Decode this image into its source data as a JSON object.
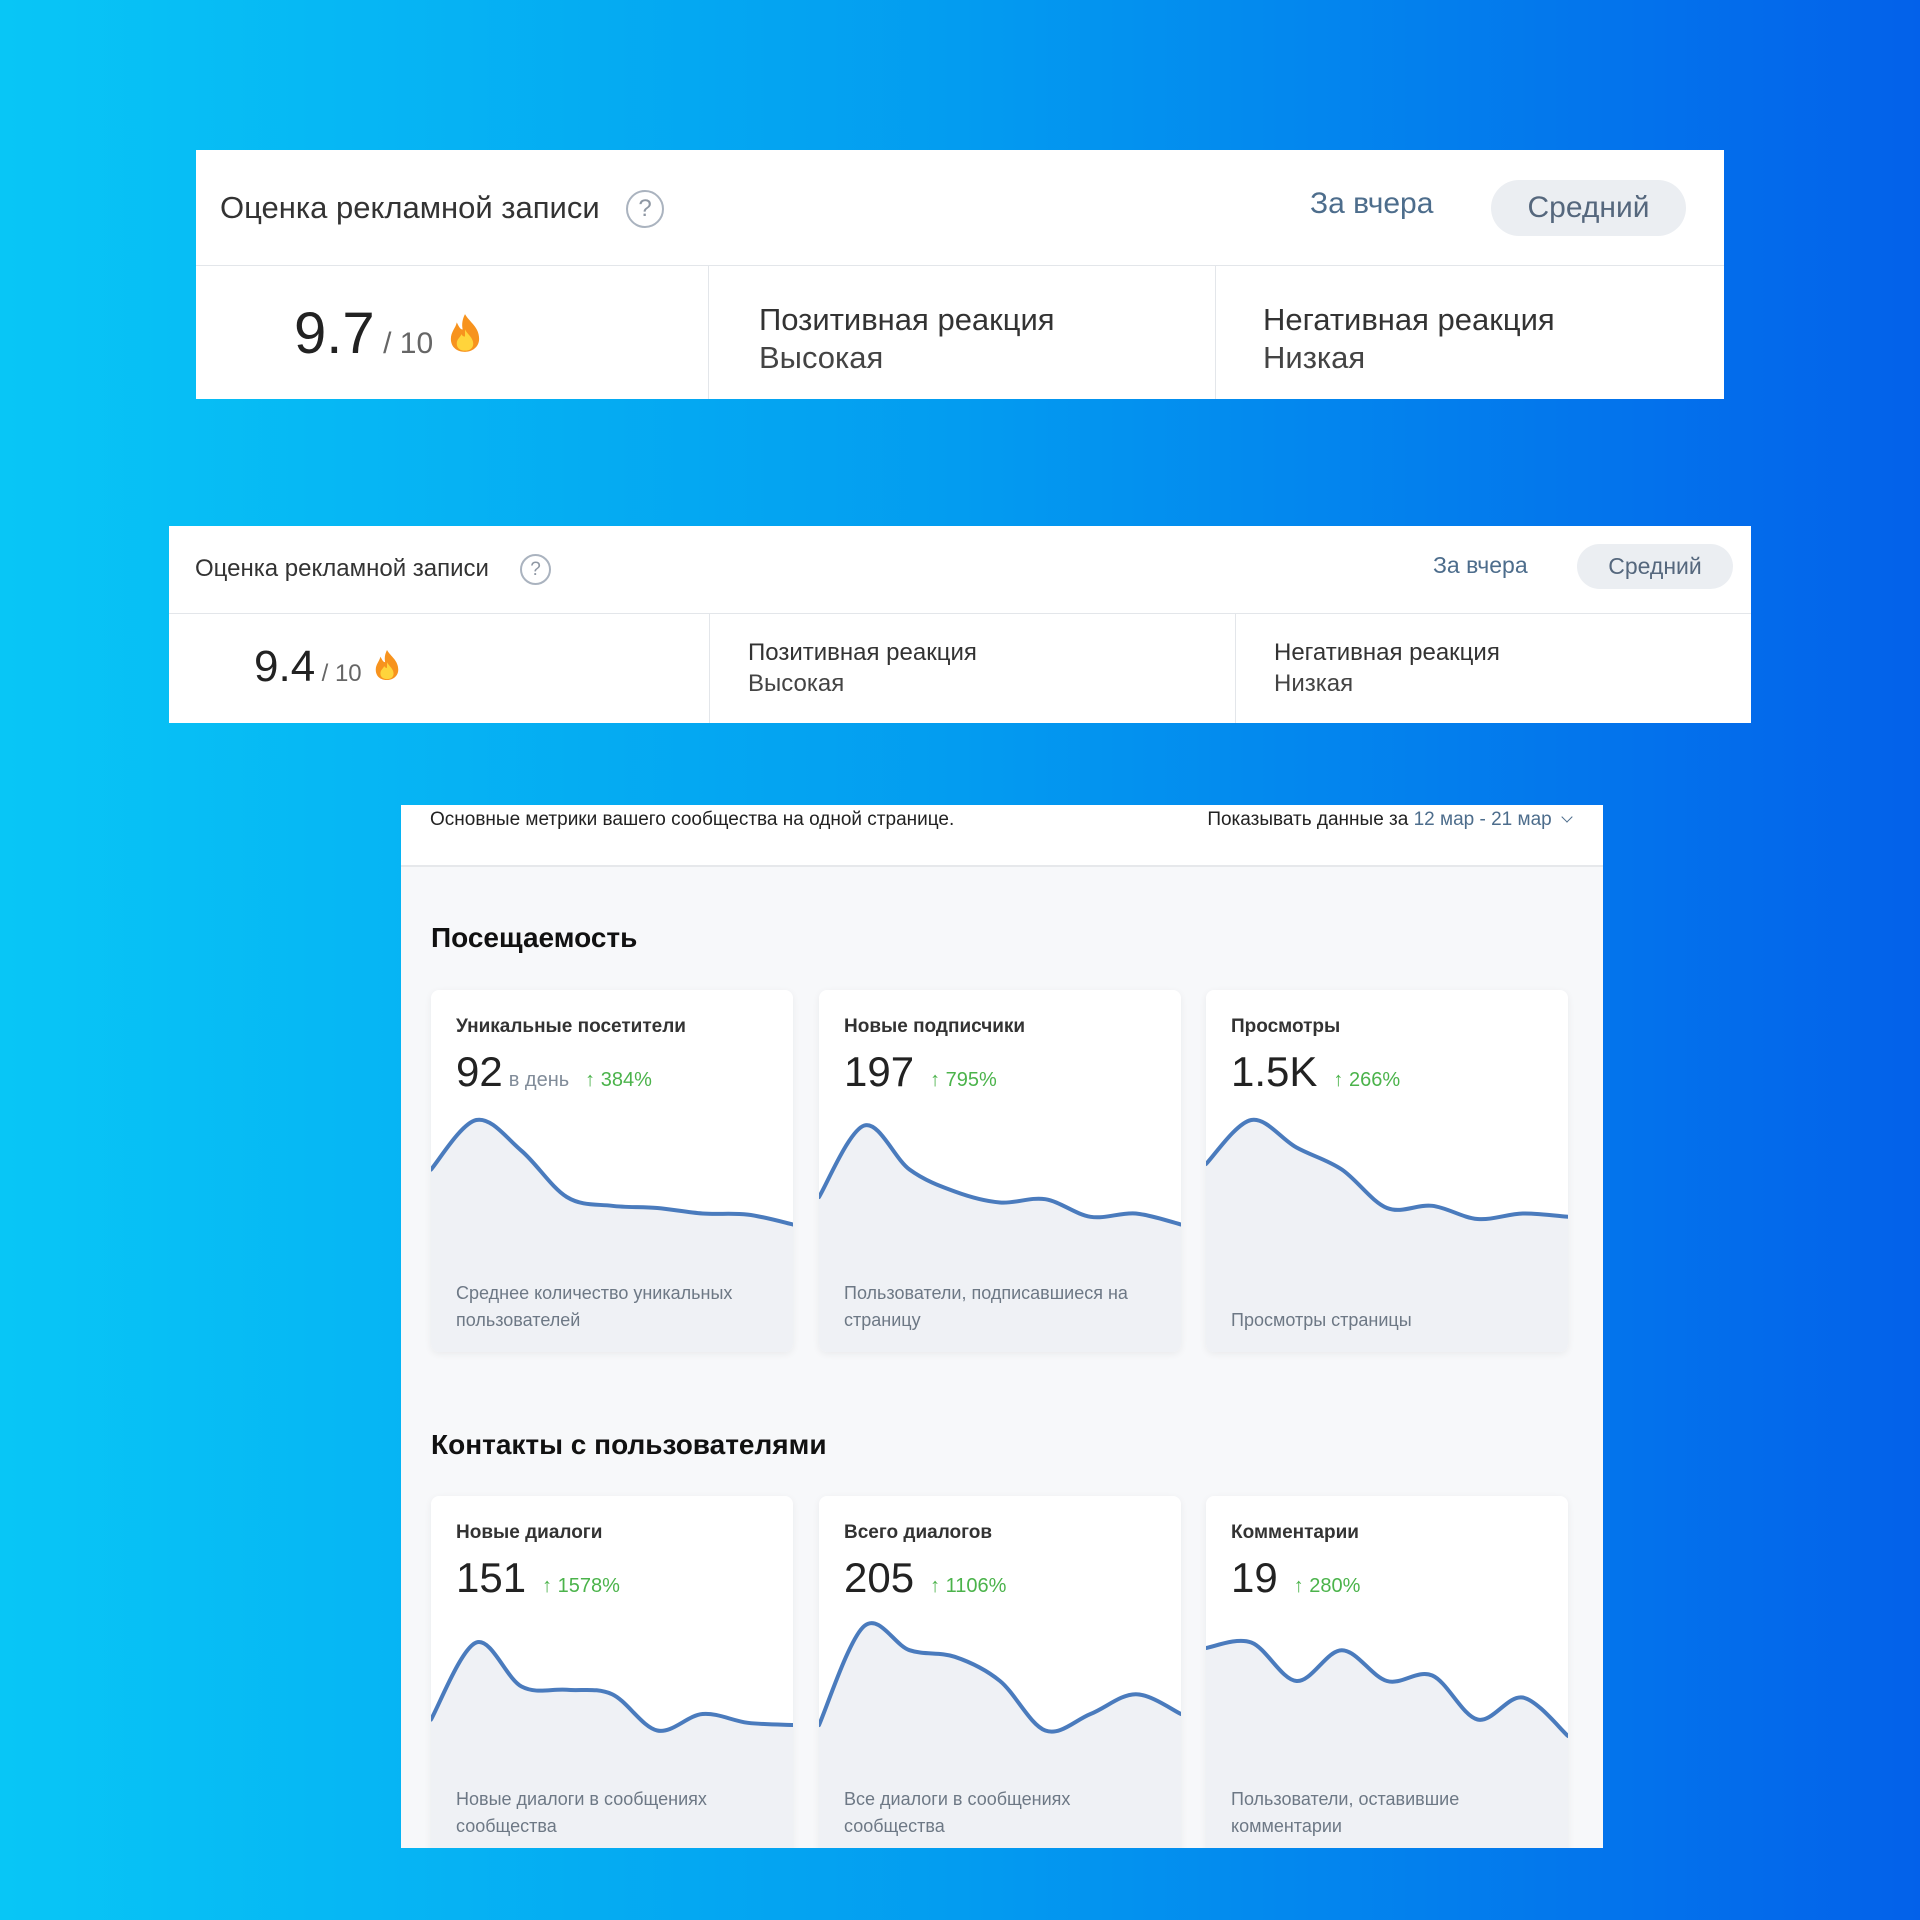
{
  "panel1": {
    "title": "Оценка рекламной записи",
    "help_icon": "question-circle-icon",
    "period_label": "За вчера",
    "level_button": "Средний",
    "score": "9.7",
    "score_max": "/ 10",
    "score_icon": "fire-icon",
    "positive": {
      "label": "Позитивная реакция",
      "value": "Высокая"
    },
    "negative": {
      "label": "Негативная реакция",
      "value": "Низкая"
    }
  },
  "panel2": {
    "title": "Оценка рекламной записи",
    "help_icon": "question-circle-icon",
    "period_label": "За вчера",
    "level_button": "Средний",
    "score": "9.4",
    "score_max": "/ 10",
    "score_icon": "fire-icon",
    "positive": {
      "label": "Позитивная реакция",
      "value": "Высокая"
    },
    "negative": {
      "label": "Негативная реакция",
      "value": "Низкая"
    }
  },
  "dashboard": {
    "subtitle": "Основные метрики вашего сообщества на одной странице.",
    "period_prefix": "Показывать данные за",
    "period_value": "12 мар - 21 мар",
    "sections": [
      {
        "title": "Посещаемость",
        "cards": [
          {
            "title": "Уникальные посетители",
            "value": "92",
            "unit": "в день",
            "delta": "384%",
            "description": "Среднее количество уникальных пользователей",
            "trend": [
              0.55,
              1.0,
              0.72,
              0.3,
              0.22,
              0.2,
              0.15,
              0.14,
              0.05
            ]
          },
          {
            "title": "Новые подписчики",
            "value": "197",
            "unit": "",
            "delta": "795%",
            "description": "Пользователи, подписавшиеся на страницу",
            "trend": [
              0.3,
              0.95,
              0.55,
              0.35,
              0.25,
              0.28,
              0.12,
              0.15,
              0.05
            ]
          },
          {
            "title": "Просмотры",
            "value": "1.5K",
            "unit": "",
            "delta": "266%",
            "description": "Просмотры страницы",
            "trend": [
              0.6,
              1.0,
              0.75,
              0.55,
              0.2,
              0.22,
              0.1,
              0.15,
              0.12
            ]
          }
        ]
      },
      {
        "title": "Контакты с пользователями",
        "cards": [
          {
            "title": "Новые диалоги",
            "value": "151",
            "unit": "",
            "delta": "1578%",
            "description": "Новые диалоги в сообщениях сообщества",
            "trend": [
              0.15,
              0.85,
              0.45,
              0.42,
              0.38,
              0.05,
              0.2,
              0.12,
              0.1
            ]
          },
          {
            "title": "Всего диалогов",
            "value": "205",
            "unit": "",
            "delta": "1106%",
            "description": "Все диалоги в сообщениях сообщества",
            "trend": [
              0.1,
              1.0,
              0.78,
              0.72,
              0.5,
              0.05,
              0.2,
              0.38,
              0.2
            ]
          },
          {
            "title": "Комментарии",
            "value": "19",
            "unit": "",
            "delta": "280%",
            "description": "Пользователи, оставившие комментарии",
            "trend": [
              0.8,
              0.85,
              0.5,
              0.78,
              0.5,
              0.55,
              0.15,
              0.35,
              0.0
            ]
          }
        ]
      }
    ]
  },
  "colors": {
    "background_start": "#08c6f6",
    "background_end": "#0361ea",
    "link_blue": "#2a5885",
    "button_bg": "#ebeef2",
    "chart_line": "#4a7bbd",
    "delta_green": "#4bb34b"
  }
}
